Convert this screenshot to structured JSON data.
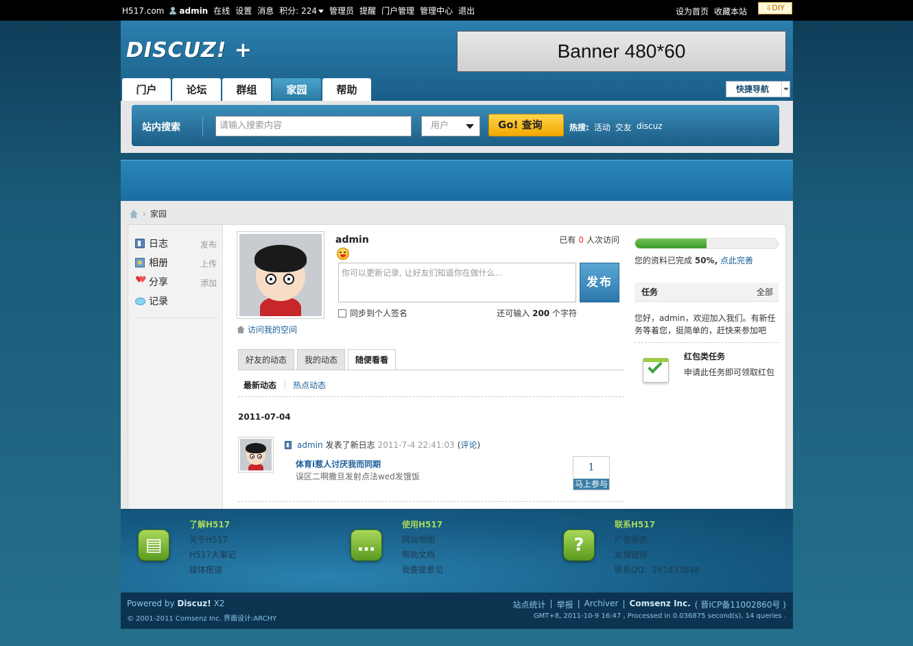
{
  "topbar": {
    "site": "H517.com",
    "username": "admin",
    "links": [
      "在线",
      "设置",
      "消息"
    ],
    "points_label": "积分: 224",
    "links2": [
      "管理员",
      "提醒",
      "门户管理",
      "管理中心",
      "退出"
    ],
    "right_links": [
      "设为首页",
      "收藏本站"
    ],
    "diy": "DIY"
  },
  "header": {
    "logo": "DISCUZ! +",
    "banner": "Banner 480*60",
    "nav": [
      "门户",
      "论坛",
      "群组",
      "家园",
      "帮助"
    ],
    "active_nav": "家园",
    "quicknav": "快捷导航"
  },
  "search": {
    "label": "站内搜索",
    "placeholder": "请输入搜索内容",
    "type": "用户",
    "button": "Go! 查询",
    "hot_label": "热搜:",
    "hot": [
      "活动",
      "交友",
      "discuz"
    ]
  },
  "breadcrumb": {
    "current": "家园"
  },
  "leftmenu": {
    "items": [
      {
        "label": "日志",
        "action": "发布",
        "icon": "blog-icon"
      },
      {
        "label": "相册",
        "action": "上传",
        "icon": "album-icon"
      },
      {
        "label": "分享",
        "action": "添加",
        "icon": "share-icon"
      },
      {
        "label": "记录",
        "action": "",
        "icon": "record-icon"
      }
    ]
  },
  "profile": {
    "username": "admin",
    "visits_prefix": "已有",
    "visits_count": "0",
    "visits_suffix": "人次访问",
    "status_placeholder": "你可以更新记录, 让好友们知道你在做什么...",
    "publish": "发布",
    "sync": "同步到个人签名",
    "remain_prefix": "还可输入",
    "remain_count": "200",
    "remain_suffix": "个字符",
    "visit_space": "访问我的空间"
  },
  "feed": {
    "tabs": [
      "好友的动态",
      "我的动态",
      "随便看看"
    ],
    "active_tab": "随便看看",
    "subtabs": [
      "最新动态",
      "热点动态"
    ],
    "date": "2011-07-04",
    "item": {
      "user": "admin",
      "action": "发表了新日志",
      "time": "2011-7-4 22:41:03",
      "comment_open": "(",
      "comment": "评论",
      "comment_close": ")",
      "title": "体育i惹人讨厌我而同期",
      "desc": "误区二啊撒旦发射点法wed发饿饭",
      "join_count": "1",
      "join_label": "马上参与"
    }
  },
  "sidebar": {
    "progress": 0.5,
    "progress_prefix": "您的资料已完成",
    "progress_pct": "50%,",
    "progress_link": "点此完善",
    "task_title": "任务",
    "task_all": "全部",
    "welcome": "您好，admin，欢迎加入我们。有新任务等着您，挺简单的，赶快来参加吧",
    "task_name": "红包类任务",
    "task_desc": "申请此任务即可领取红包"
  },
  "footer": {
    "cols": [
      {
        "title": "了解H517",
        "links": [
          "关于H517",
          "H517大事记",
          "媒体报道"
        ]
      },
      {
        "title": "使用H517",
        "links": [
          "网站地图",
          "帮助文档",
          "我要提意见"
        ]
      },
      {
        "title": "联系H517",
        "links": [
          "广告服务",
          "友情链接",
          "联系QQ：261833848"
        ]
      }
    ],
    "powered_prefix": "Powered by",
    "powered_brand": "Discuz!",
    "powered_ver": "X2",
    "copyright": "© 2001-2011 Comsenz Inc. 界面设计:ARCHY",
    "links": [
      "站点统计",
      "举报",
      "Archiver"
    ],
    "company": "Comsenz Inc.",
    "icp": "( 晋ICP备11002860号 )",
    "gmt": "GMT+8, 2011-10-9 16:47 , Processed in 0.036875 second(s), 14 queries ."
  },
  "colors": {
    "accent": "#1a5e99",
    "header": "#2b7fae",
    "go": "#f3a800",
    "progress": "#4ea832"
  }
}
